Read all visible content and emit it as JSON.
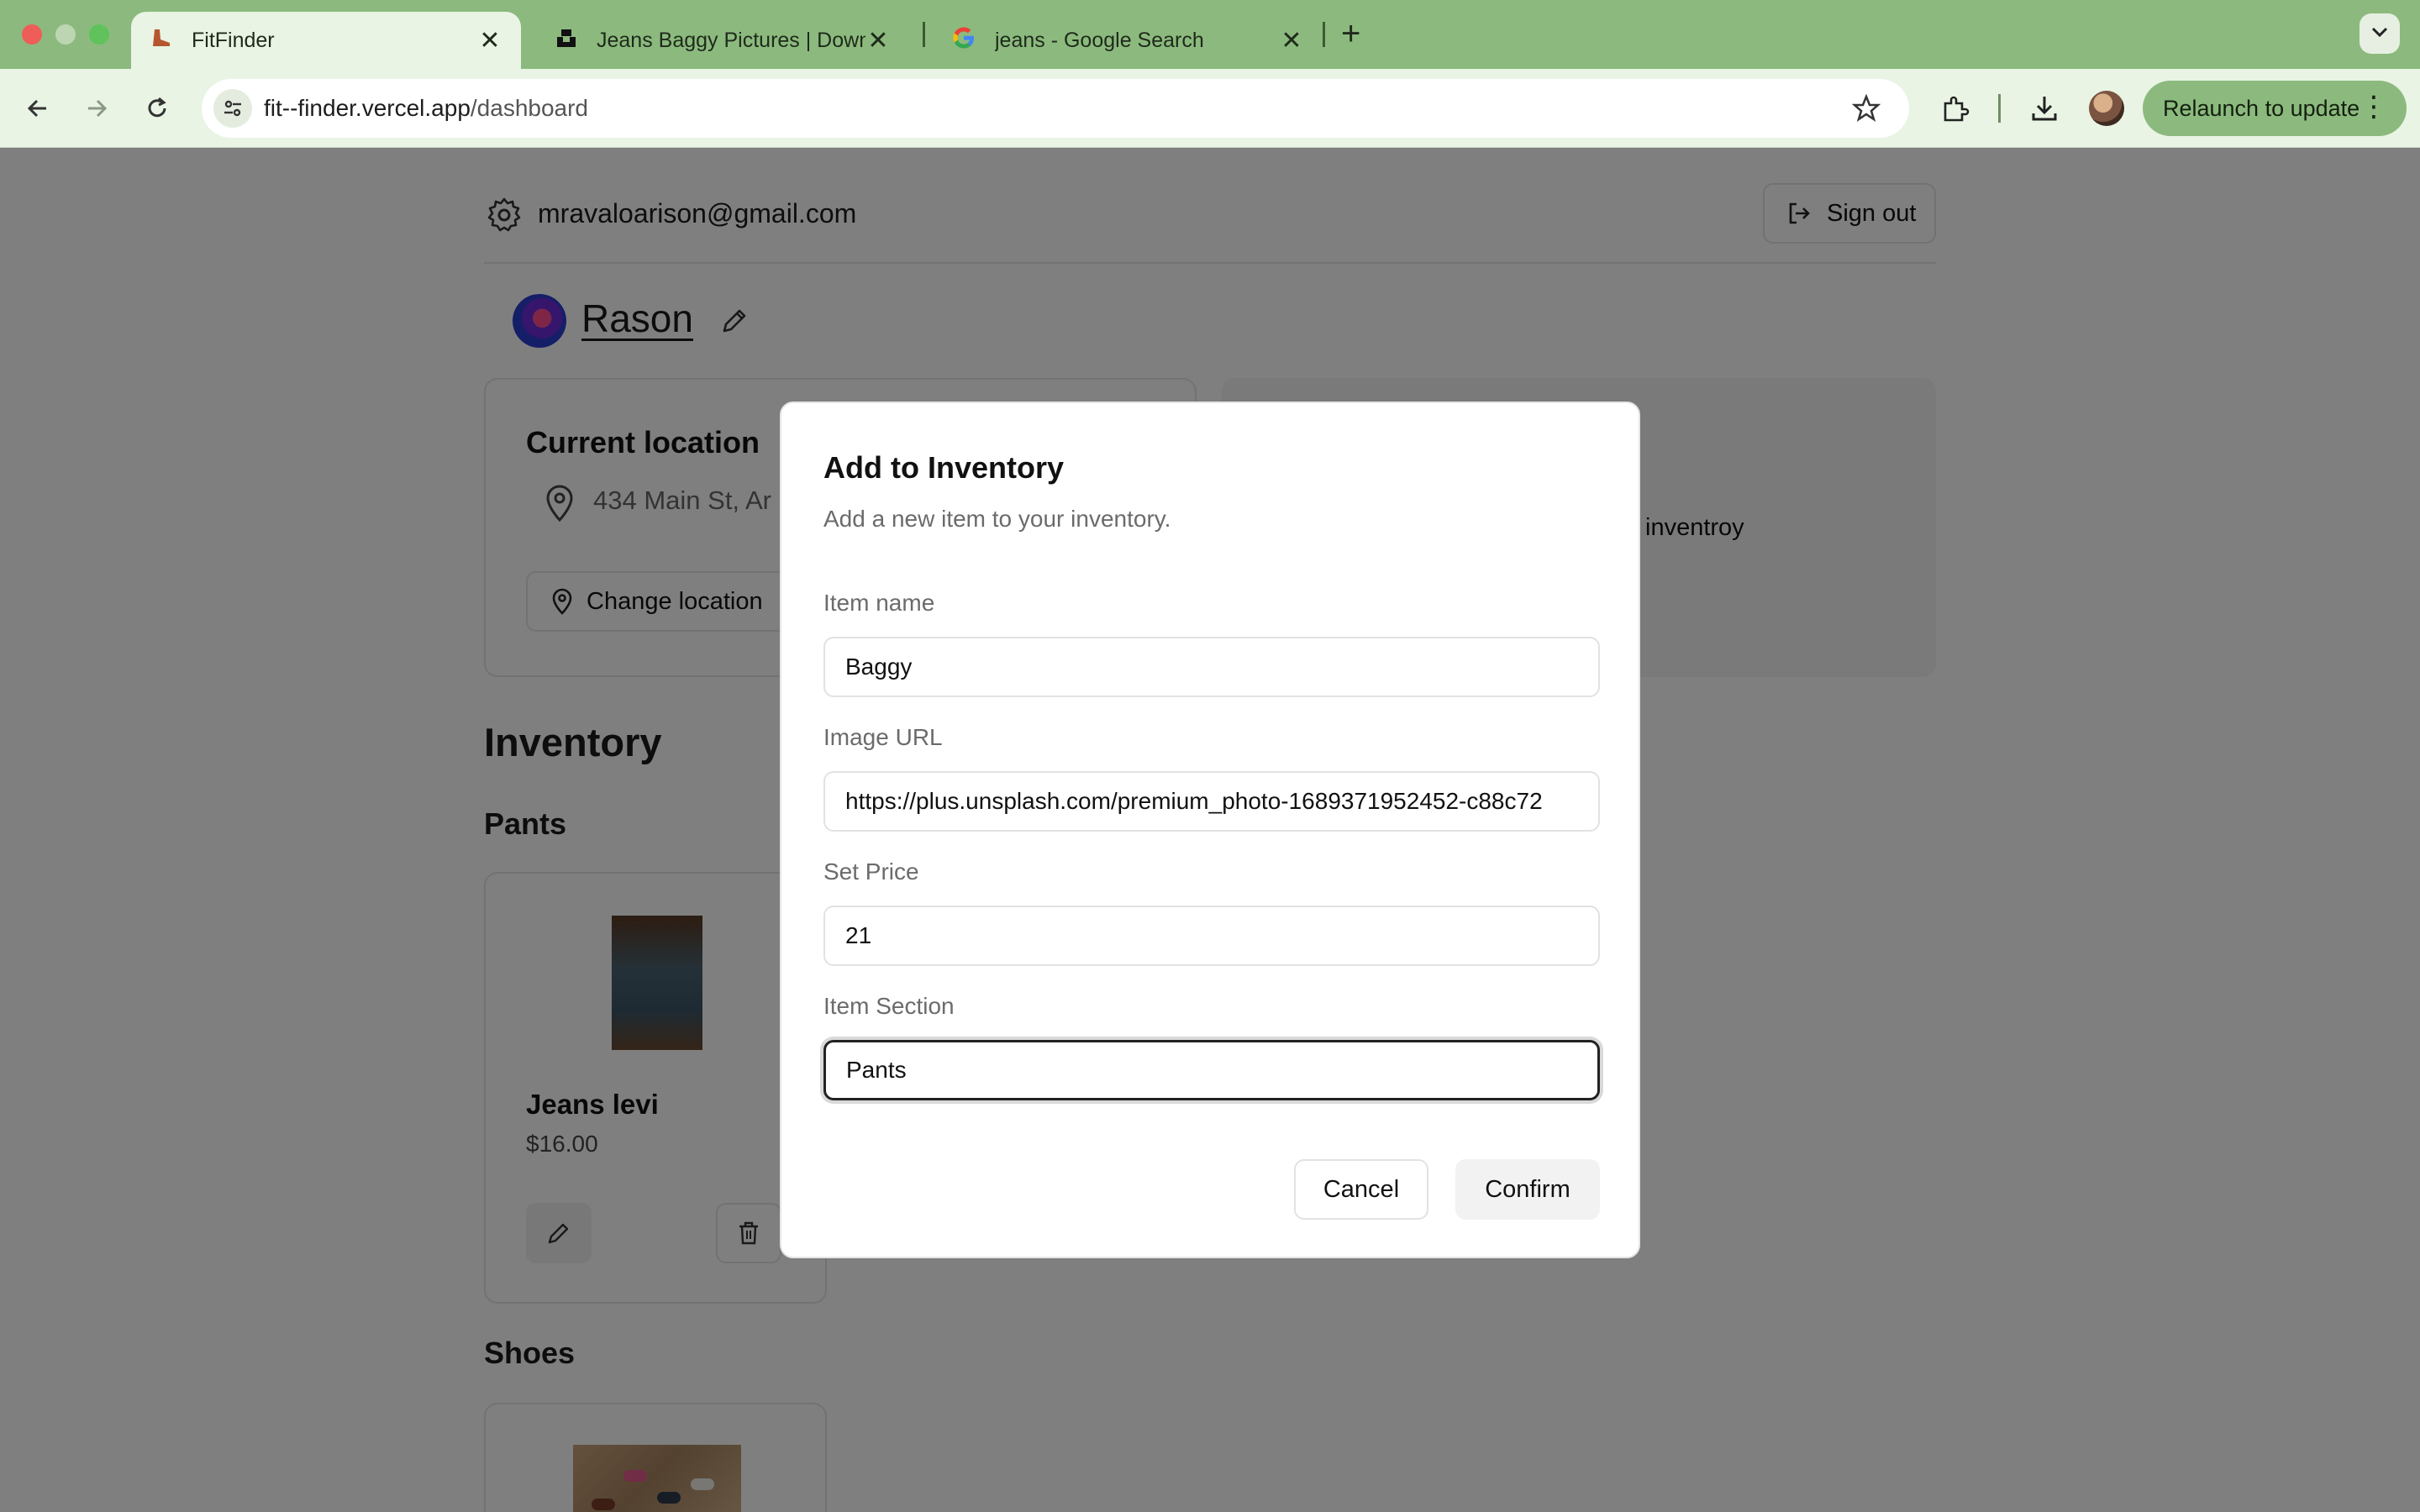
{
  "browser": {
    "tabs": [
      {
        "title": "FitFinder",
        "icon": "boot-favicon",
        "active": true
      },
      {
        "title": "Jeans Baggy Pictures | Downl",
        "icon": "unsplash-favicon"
      },
      {
        "title": "jeans - Google Search",
        "icon": "google-favicon"
      }
    ],
    "close_glyph": "✕",
    "new_tab_glyph": "+",
    "url_host": "fit--finder.vercel.app",
    "url_path": "/dashboard",
    "relaunch_label": "Relaunch to update",
    "menu_glyph": "⋮",
    "theme_color": "#8cba7e"
  },
  "header": {
    "email": "mravaloarison@gmail.com",
    "sign_out": "Sign out"
  },
  "profile": {
    "name": "Rason"
  },
  "location": {
    "title": "Current location",
    "address": "434 Main St, Ar",
    "change_button": "Change location"
  },
  "inventory_card": {
    "note": "inventroy"
  },
  "inventory": {
    "title": "Inventory",
    "sections": [
      {
        "name": "Pants",
        "items": [
          {
            "name": "Jeans levi",
            "price": "$16.00"
          }
        ]
      },
      {
        "name": "Shoes",
        "items": []
      }
    ]
  },
  "dialog": {
    "title": "Add to Inventory",
    "description": "Add a new item to your inventory.",
    "fields": {
      "item_name": {
        "label": "Item name",
        "value": "Baggy"
      },
      "image_url": {
        "label": "Image URL",
        "value": "https://plus.unsplash.com/premium_photo-1689371952452-c88c72"
      },
      "price": {
        "label": "Set Price",
        "value": "21"
      },
      "section": {
        "label": "Item Section",
        "value": "Pants"
      }
    },
    "cancel": "Cancel",
    "confirm": "Confirm"
  }
}
